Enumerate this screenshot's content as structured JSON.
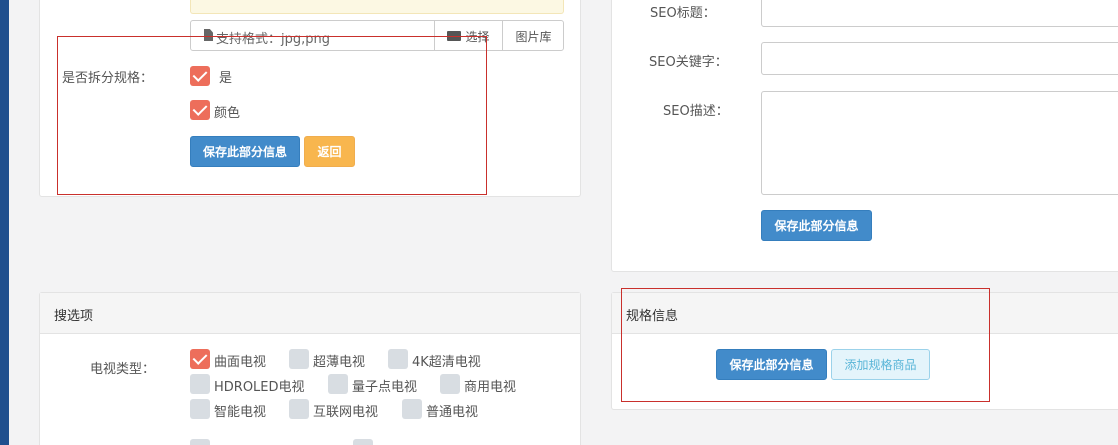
{
  "upload": {
    "placeholder": "支持格式：jpg,png",
    "select_label": "选择",
    "gallery_label": "图片库"
  },
  "split_spec": {
    "label": "是否拆分规格：",
    "options": [
      {
        "label": "是",
        "checked": true
      },
      {
        "label": "颜色",
        "checked": true
      }
    ],
    "save_label": "保存此部分信息",
    "back_label": "返回"
  },
  "seo": {
    "title_label": "SEO标题：",
    "keywords_label": "SEO关键字：",
    "desc_label": "SEO描述：",
    "save_label": "保存此部分信息"
  },
  "search_options": {
    "header": "搜选项",
    "tv_type_label": "电视类型：",
    "items": [
      {
        "label": "曲面电视",
        "checked": true
      },
      {
        "label": "超薄电视",
        "checked": false
      },
      {
        "label": "4K超清电视",
        "checked": false
      },
      {
        "label": "HDROLED电视",
        "checked": false
      },
      {
        "label": "量子点电视",
        "checked": false
      },
      {
        "label": "商用电视",
        "checked": false
      },
      {
        "label": "智能电视",
        "checked": false
      },
      {
        "label": "互联网电视",
        "checked": false
      },
      {
        "label": "普通电视",
        "checked": false
      }
    ]
  },
  "spec_info": {
    "header": "规格信息",
    "save_label": "保存此部分信息",
    "add_label": "添加规格商品"
  },
  "colors": {
    "accent": "#428bca",
    "checked": "#ed6e5b",
    "warning": "#f8b64e",
    "highlight": "#c9302c"
  }
}
